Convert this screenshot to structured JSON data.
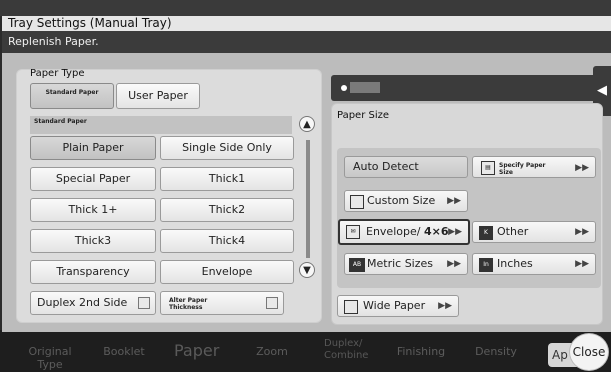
{
  "dialog": {
    "title": "Tray Settings (Manual Tray)",
    "message": "Replenish Paper."
  },
  "paper_type": {
    "label": "Paper Type",
    "tabs": [
      {
        "label": "Standard Paper",
        "selected": true
      },
      {
        "label": "User Paper",
        "selected": false
      }
    ],
    "sub_header": "Standard Paper",
    "items": [
      {
        "label": "Plain Paper",
        "selected": true
      },
      {
        "label": "Single Side Only",
        "selected": false
      },
      {
        "label": "Special Paper",
        "selected": false
      },
      {
        "label": "Thick1",
        "selected": false
      },
      {
        "label": "Thick 1+",
        "selected": false
      },
      {
        "label": "Thick2",
        "selected": false
      },
      {
        "label": "Thick3",
        "selected": false
      },
      {
        "label": "Thick4",
        "selected": false
      },
      {
        "label": "Transparency",
        "selected": false
      },
      {
        "label": "Envelope",
        "selected": false
      }
    ],
    "duplex_2nd_side": "Duplex 2nd Side",
    "alter_paper_thickness": "Alter Paper Thickness"
  },
  "paper_size": {
    "label": "Paper Size",
    "auto_detect": "Auto Detect",
    "specify_paper_size": "Specify Paper Size",
    "custom_size": "Custom Size",
    "envelope": "Envelope/",
    "envelope_size": "4×6",
    "other": "Other",
    "metric_sizes": "Metric Sizes",
    "inches": "Inches",
    "wide_paper": "Wide Paper"
  },
  "background_tabs": {
    "original_type": "Original Type",
    "booklet": "Booklet",
    "paper": "Paper",
    "zoom": "Zoom",
    "duplex_combine": "Duplex/ Combine",
    "finishing": "Finishing",
    "density": "Density",
    "apply_partial": "Ap"
  },
  "close_label": "Close"
}
